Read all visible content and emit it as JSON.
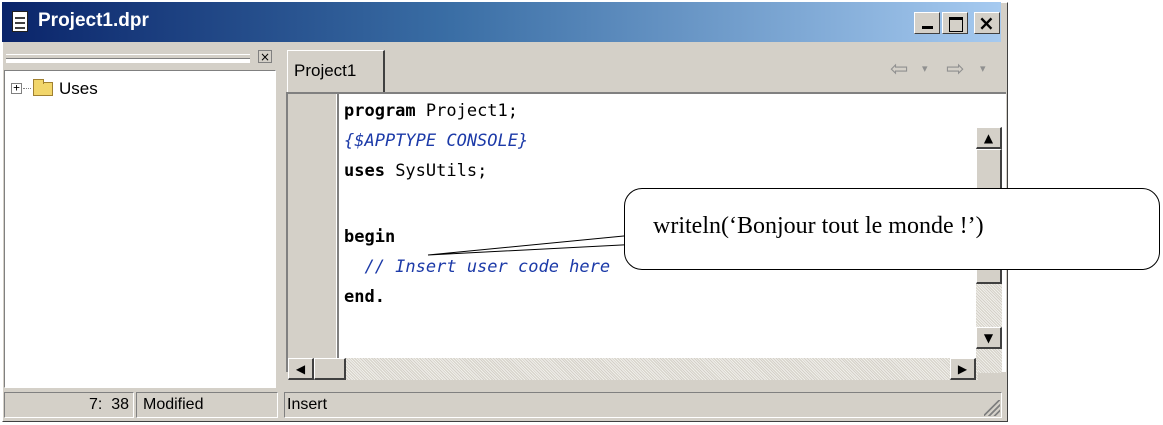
{
  "window": {
    "title": "Project1.dpr",
    "controls": {
      "minimize_icon": "minimize-icon",
      "maximize_icon": "maximize-icon",
      "close_icon": "close-icon"
    }
  },
  "explorer": {
    "panel_close": "×",
    "tree": [
      {
        "label": "Uses",
        "expander": "+",
        "icon": "folder-icon"
      }
    ]
  },
  "editor": {
    "tab_label": "Project1",
    "nav": {
      "back": "⇦",
      "forward": "⇨",
      "drop": "▾"
    },
    "code_lines": [
      {
        "keyword": "program",
        "rest": " Project1;"
      },
      {
        "directive": "{$APPTYPE CONSOLE}"
      },
      {
        "keyword": "uses",
        "rest": " SysUtils;"
      },
      {
        "blank": ""
      },
      {
        "keyword": "begin",
        "rest": ""
      },
      {
        "comment": "  // Insert user code here"
      },
      {
        "keyword": "end.",
        "rest": ""
      }
    ]
  },
  "status": {
    "position": "7:  38",
    "modified": "Modified",
    "mode": "Insert"
  },
  "callout": {
    "text": "writeln(‘Bonjour tout le monde !’)"
  }
}
